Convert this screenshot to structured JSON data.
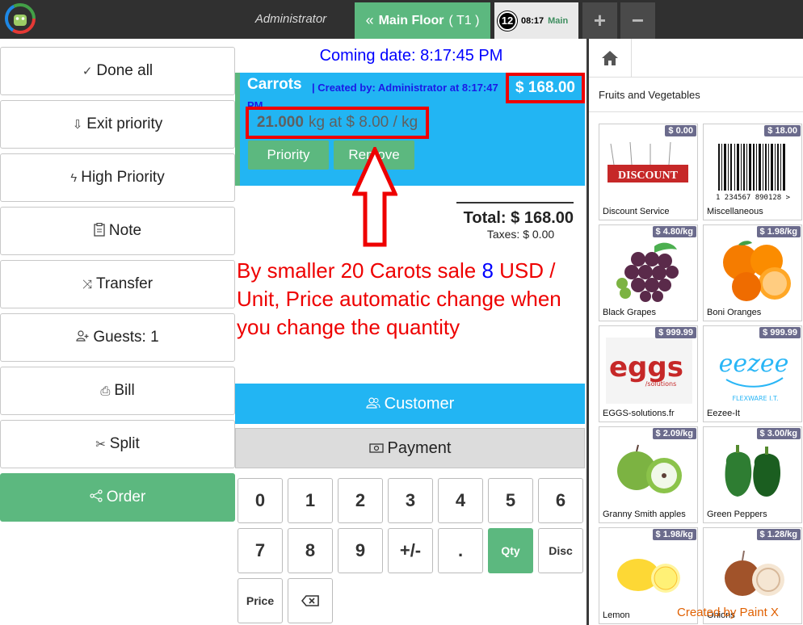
{
  "topbar": {
    "user": "Administrator",
    "floor_label": "Main Floor",
    "table_label": "( T1 )",
    "badge_count": "12",
    "time": "08:17",
    "main_label": "Main",
    "add_label": "+",
    "remove_label": "−"
  },
  "actions": [
    {
      "label": "Done all",
      "icon": "check-circle-icon",
      "glyph": "✓"
    },
    {
      "label": "Exit priority",
      "icon": "arrow-down-circle-icon",
      "glyph": "⇩"
    },
    {
      "label": "High Priority",
      "icon": "lightning-icon",
      "glyph": "ϟ"
    },
    {
      "label": "Note",
      "icon": "clipboard-icon",
      "glyph": "📋"
    },
    {
      "label": "Transfer",
      "icon": "shuffle-icon",
      "glyph": "⤨"
    },
    {
      "label": "Guests: 1",
      "icon": "user-plus-icon",
      "glyph": "👤"
    },
    {
      "label": "Bill",
      "icon": "printer-icon",
      "glyph": "⎙"
    },
    {
      "label": "Split",
      "icon": "scissors-icon",
      "glyph": "✂"
    },
    {
      "label": "Order",
      "icon": "share-icon",
      "glyph": "⋖"
    }
  ],
  "order": {
    "coming_date": "Coming date: 8:17:45 PM",
    "line": {
      "product": "Carrots",
      "created": "| Created by: Administrator at 8:17:47 PM",
      "price": "$ 168.00",
      "quantity": "21.000",
      "unit_price": "kg at $ 8.00 / kg",
      "priority_label": "Priority",
      "remove_label": "Remove"
    },
    "total": "Total: $ 168.00",
    "taxes": "Taxes: $ 0.00"
  },
  "annotation": {
    "text_before": "By smaller 20 Carots sale ",
    "text_highlight": "8",
    "text_after": " USD / Unit, Price automatic change when you change the quantity"
  },
  "buttons": {
    "customer": "Customer",
    "payment": "Payment"
  },
  "keypad": {
    "row1": [
      "0",
      "1",
      "2",
      "3",
      "4",
      "5",
      "6"
    ],
    "row2": [
      "7",
      "8",
      "9",
      "+/-",
      ".",
      "Qty",
      "Disc"
    ],
    "row3": [
      "Price",
      "⌫"
    ]
  },
  "category": {
    "title": "Fruits and Vegetables"
  },
  "products": [
    {
      "name": "Discount Service",
      "price": "$ 0.00"
    },
    {
      "name": "Miscellaneous",
      "price": "$ 18.00"
    },
    {
      "name": "Black Grapes",
      "price": "$ 4.80/kg"
    },
    {
      "name": "Boni Oranges",
      "price": "$ 1.98/kg"
    },
    {
      "name": "EGGS-solutions.fr",
      "price": "$ 999.99"
    },
    {
      "name": "Eezee-It",
      "price": "$ 999.99"
    },
    {
      "name": "Granny Smith apples",
      "price": "$ 2.09/kg"
    },
    {
      "name": "Green Peppers",
      "price": "$ 3.00/kg"
    },
    {
      "name": "Lemon",
      "price": "$ 1.98/kg"
    },
    {
      "name": "Onions",
      "price": "$ 1.28/kg"
    }
  ],
  "product_art": {
    "discount_text": "DISCOUNT",
    "barcode_digits": "1 234567 890128 >",
    "eggs_logo": "eggs",
    "eggs_sub": "/solutions",
    "eezee_logo": "eezee",
    "eezee_sub": "FLEXWARE I.T."
  },
  "credit": "Created by Paint X",
  "colors": {
    "green": "#5cb87f",
    "blue": "#22b5f3",
    "highlight_red": "#ee0000",
    "annotation_blue": "#0000ff",
    "topbar": "#303030"
  }
}
